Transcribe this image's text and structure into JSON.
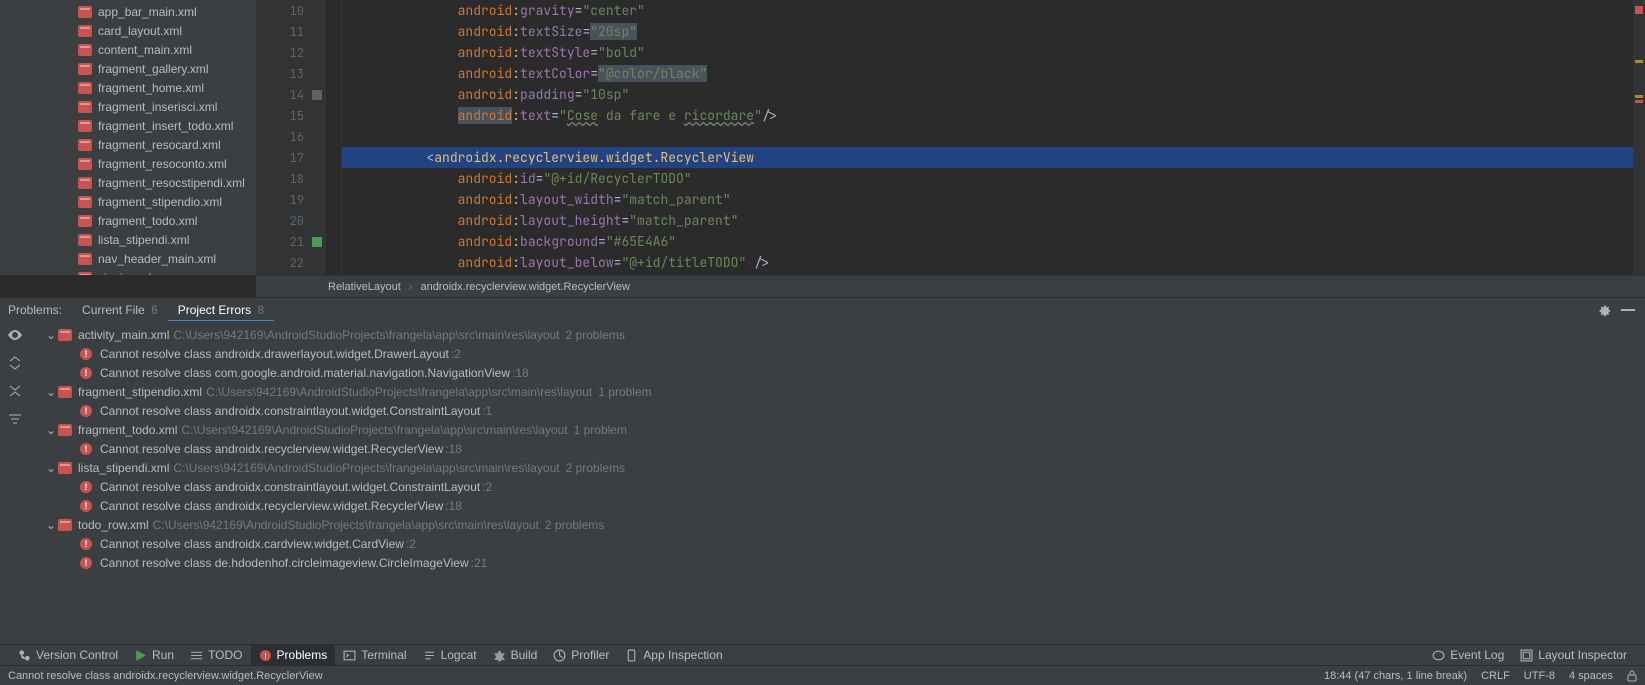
{
  "sidebar": {
    "files": [
      "app_bar_main.xml",
      "card_layout.xml",
      "content_main.xml",
      "fragment_gallery.xml",
      "fragment_home.xml",
      "fragment_inserisci.xml",
      "fragment_insert_todo.xml",
      "fragment_resocard.xml",
      "fragment_resoconto.xml",
      "fragment_resocstipendi.xml",
      "fragment_stipendio.xml",
      "fragment_todo.xml",
      "lista_stipendi.xml",
      "nav_header_main.xml",
      "signin.xml"
    ]
  },
  "editor": {
    "lines": [
      {
        "n": 10,
        "pre": "            ",
        "ns": "android",
        "attr": "gravity",
        "val": "\"center\""
      },
      {
        "n": 11,
        "pre": "            ",
        "ns": "android",
        "attr": "textSize",
        "val": "\"20sp\"",
        "selval": true
      },
      {
        "n": 12,
        "pre": "            ",
        "ns": "android",
        "attr": "textStyle",
        "val": "\"bold\""
      },
      {
        "n": 13,
        "pre": "            ",
        "ns": "android",
        "attr": "textColor",
        "val": "\"@color/black\"",
        "selval": true
      },
      {
        "n": 14,
        "marker": "sq",
        "pre": "            ",
        "ns": "android",
        "attr": "padding",
        "val": "\"10sp\""
      },
      {
        "n": 15,
        "pre": "            ",
        "ns": "android",
        "attr": "text",
        "val_html": "<span class='k-str'>\"<span class='underline'>Cose</span> da fare e <span class='underline'>ricordare</span>\"</span>",
        "tail": "/>",
        "selns": true
      },
      {
        "n": 16,
        "blank": true
      },
      {
        "n": 17,
        "hl": true,
        "raw_html": "        <span class='k-punc'>&lt;</span><span class='k-tag'>androidx.recyclerview.widget.RecyclerView</span>"
      },
      {
        "n": 18,
        "pre": "            ",
        "ns": "android",
        "attr": "id",
        "val": "\"@+id/RecyclerTODO\""
      },
      {
        "n": 19,
        "pre": "            ",
        "ns": "android",
        "attr": "layout_width",
        "val": "\"match_parent\""
      },
      {
        "n": 20,
        "pre": "            ",
        "ns": "android",
        "attr": "layout_height",
        "val": "\"match_parent\""
      },
      {
        "n": 21,
        "marker": "green",
        "pre": "            ",
        "ns": "android",
        "attr": "background",
        "val": "\"#65E4A6\""
      },
      {
        "n": 22,
        "pre": "            ",
        "ns": "android",
        "attr": "layout_below",
        "val": "\"@+id/titleTODO\"",
        "tail": " />"
      }
    ],
    "first_line_no": 10
  },
  "breadcrumb": {
    "a": "RelativeLayout",
    "b": "androidx.recyclerview.widget.RecyclerView"
  },
  "problemsTabs": {
    "label": "Problems:",
    "currentFile": {
      "label": "Current File",
      "count": "6"
    },
    "projectErrors": {
      "label": "Project Errors",
      "count": "8"
    }
  },
  "problems": [
    {
      "file": "activity_main.xml",
      "path": "C:\\Users\\942169\\AndroidStudioProjects\\frangela\\app\\src\\main\\res\\layout",
      "count": "2 problems",
      "errors": [
        {
          "msg": "Cannot resolve class androidx.drawerlayout.widget.DrawerLayout",
          "loc": ":2"
        },
        {
          "msg": "Cannot resolve class com.google.android.material.navigation.NavigationView",
          "loc": ":18"
        }
      ]
    },
    {
      "file": "fragment_stipendio.xml",
      "path": "C:\\Users\\942169\\AndroidStudioProjects\\frangela\\app\\src\\main\\res\\layout",
      "count": "1 problem",
      "errors": [
        {
          "msg": "Cannot resolve class androidx.constraintlayout.widget.ConstraintLayout",
          "loc": ":1"
        }
      ]
    },
    {
      "file": "fragment_todo.xml",
      "path": "C:\\Users\\942169\\AndroidStudioProjects\\frangela\\app\\src\\main\\res\\layout",
      "count": "1 problem",
      "errors": [
        {
          "msg": "Cannot resolve class androidx.recyclerview.widget.RecyclerView",
          "loc": ":18"
        }
      ]
    },
    {
      "file": "lista_stipendi.xml",
      "path": "C:\\Users\\942169\\AndroidStudioProjects\\frangela\\app\\src\\main\\res\\layout",
      "count": "2 problems",
      "errors": [
        {
          "msg": "Cannot resolve class androidx.constraintlayout.widget.ConstraintLayout",
          "loc": ":2"
        },
        {
          "msg": "Cannot resolve class androidx.recyclerview.widget.RecyclerView",
          "loc": ":18"
        }
      ]
    },
    {
      "file": "todo_row.xml",
      "path": "C:\\Users\\942169\\AndroidStudioProjects\\frangela\\app\\src\\main\\res\\layout",
      "count": "2 problems",
      "errors": [
        {
          "msg": "Cannot resolve class androidx.cardview.widget.CardView",
          "loc": ":2"
        },
        {
          "msg": "Cannot resolve class de.hdodenhof.circleimageview.CircleImageView",
          "loc": ":21"
        }
      ]
    }
  ],
  "bottomBar": {
    "versionControl": "Version Control",
    "run": "Run",
    "todo": "TODO",
    "problems": "Problems",
    "terminal": "Terminal",
    "logcat": "Logcat",
    "build": "Build",
    "profiler": "Profiler",
    "appInspection": "App Inspection",
    "eventLog": "Event Log",
    "layoutInspector": "Layout Inspector"
  },
  "statusBar": {
    "message": "Cannot resolve class androidx.recyclerview.widget.RecyclerView",
    "pos": "18:44 (47 chars, 1 line break)",
    "eol": "CRLF",
    "enc": "UTF-8",
    "indent": "4 spaces"
  }
}
